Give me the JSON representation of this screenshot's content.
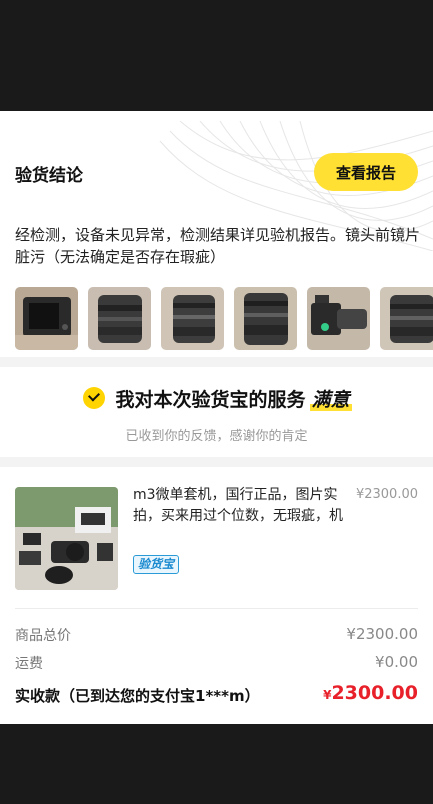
{
  "inspection": {
    "title": "验货结论",
    "report_button": "查看报告",
    "text": "经检测，设备未见异常，检测结果详见验机报告。镜头前镜片脏污（无法确定是否存在瑕疵）",
    "photo_count": 6
  },
  "satisfaction": {
    "prefix": "我对本次验货宝的服务",
    "rating": "满意",
    "subtitle": "已收到你的反馈，感谢你的肯定"
  },
  "product": {
    "title": "m3微单套机，国行正品，图片实拍，买来用过个位数，无瑕疵，机",
    "price": "¥2300.00",
    "badge": "验货宝"
  },
  "summary": {
    "total_label": "商品总价",
    "total_value": "¥2300.00",
    "shipping_label": "运费",
    "shipping_value": "¥0.00",
    "received_label": "实收款（已到达您的支付宝1***m）",
    "received_currency": "¥",
    "received_value": "2300.00"
  },
  "colors": {
    "accent_yellow": "#ffe033",
    "price_red": "#e8202a",
    "badge_blue": "#1a8ad0"
  }
}
